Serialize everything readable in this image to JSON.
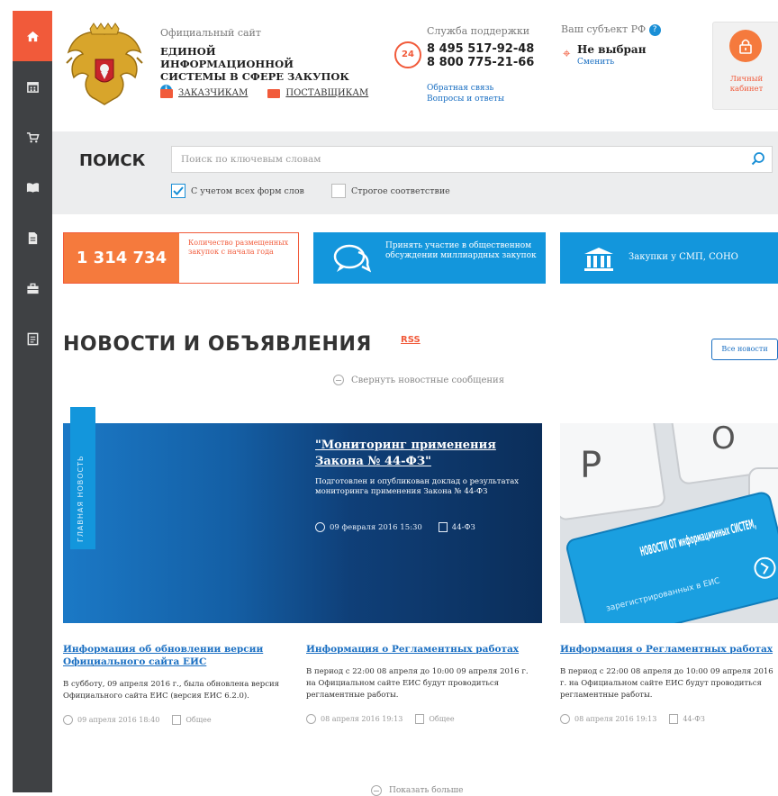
{
  "sidebar": {
    "items": [
      {
        "icon": "home-icon",
        "active": true
      },
      {
        "icon": "calendar-icon"
      },
      {
        "icon": "cart-icon"
      },
      {
        "icon": "book-icon"
      },
      {
        "icon": "document-icon"
      },
      {
        "icon": "briefcase-icon"
      },
      {
        "icon": "notes-icon"
      }
    ]
  },
  "header": {
    "official_site": "Официальный сайт",
    "title": "ЕДИНОЙ ИНФОРМАЦИОННОЙ СИСТЕМЫ В СФЕРЕ ЗАКУПОК",
    "link_customers": "ЗАКАЗЧИКАМ",
    "link_suppliers": "ПОСТАВЩИКАМ",
    "support_caption": "Служба поддержки",
    "support_badge": "24",
    "phone_1": "8 495 517-92-48",
    "phone_2": "8 800 775-21-66",
    "feedback_link": "Обратная связь",
    "questions_link": "Вопросы и ответы",
    "region_caption": "Ваш субъект РФ",
    "region_value": "Не выбран",
    "region_change": "Сменить",
    "cabinet_label": "Личный кабинет"
  },
  "search": {
    "label": "ПОИСК",
    "placeholder": "Поиск по ключевым словам",
    "checkbox_morphology": "С учетом всех форм слов",
    "checkbox_morphology_checked": true,
    "checkbox_strict": "Строгое соответствие",
    "checkbox_strict_checked": false
  },
  "tiles": {
    "count_value": "1 314 734",
    "count_text": "Количество размещенных закупок с начала года",
    "discussion_text": "Принять участие в общественном обсуждении миллиардных закупок",
    "smp_text": "Закупки у СМП, СОНО"
  },
  "news": {
    "heading": "НОВОСТИ И ОБЪЯВЛЕНИЯ",
    "rss": "RSS",
    "all_news": "Все новости",
    "collapse": "Свернуть новостные сообщения",
    "main_tag": "ГЛАВНАЯ НОВОСТЬ",
    "feature": {
      "title": "\"Мониторинг применения Закона № 44-ФЗ\"",
      "description": "Подготовлен и опубликован доклад о результатах мониторинга применения Закона № 44-ФЗ",
      "date": "09 февраля 2016 15:30",
      "category": "44-ФЗ"
    },
    "promo_badge": "НОВОСТИ ОТ информационных СИСТЕМ,",
    "promo_sub": "зарегистрированных в ЕИС",
    "cards": [
      {
        "title": "Информация об обновлении версии Официального сайта ЕИС",
        "description": "В субботу, 09 апреля 2016 г., была обновлена версия Официального сайта ЕИС (версия ЕИС 6.2.0).",
        "date": "09 апреля 2016 18:40",
        "category": "Общее"
      },
      {
        "title": "Информация о Регламентных работах",
        "description": "В период с 22:00 08 апреля до 10:00 09 апреля 2016 г. на Официальном сайте ЕИС будут проводиться регламентные работы.",
        "date": "08 апреля 2016 19:13",
        "category": "Общее"
      },
      {
        "title": "Информация о Регламентных работах",
        "description": "В период с 22:00 08 апреля до 10:00 09 апреля 2016 г. на Официальном сайте ЕИС будут проводиться регламентные работы.",
        "date": "08 апреля 2016 19:13",
        "category": "44-ФЗ"
      }
    ],
    "more": "Показать больше"
  },
  "colors": {
    "accent": "#f15a3a",
    "blue": "#1396dc",
    "sidebar": "#3f4144"
  }
}
